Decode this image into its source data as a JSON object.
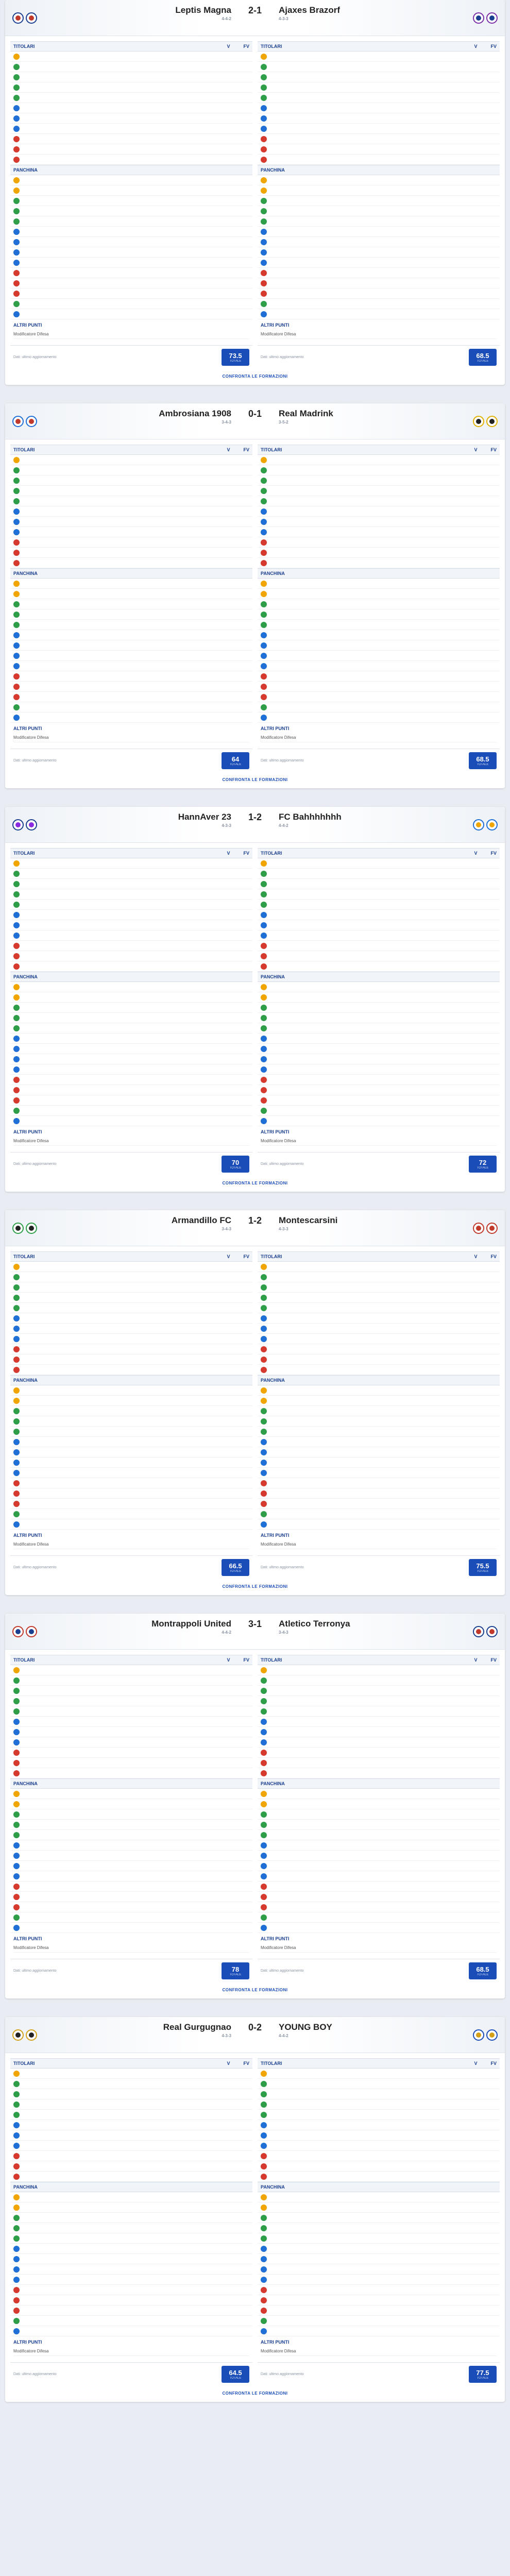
{
  "ui": {
    "titolari": "TITOLARI",
    "panchina": "PANCHINA",
    "altri_punti": "ALTRI PUNTI",
    "mod_difesa": "Modificatore Difesa",
    "totale": "TOTALE",
    "nota": "Dati: ultimo aggiornamento",
    "formazioni": "CONFRONTA LE FORMAZIONI",
    "v": "V",
    "fv": "FV"
  },
  "matches": [
    {
      "home": "Leptis Magna",
      "away": "Ajaxes Brazorf",
      "score": "2-1",
      "home_sub": "4-4-2",
      "away_sub": "4-3-3",
      "home_total": "73.5",
      "away_total": "68.5",
      "home_colors": [
        "#1a3f8f",
        "#c0392b"
      ],
      "away_colors": [
        "#7b2fa8",
        "#1a3f8f"
      ]
    },
    {
      "home": "Ambrosiana 1908",
      "away": "Real Madrink",
      "score": "0-1",
      "home_sub": "3-4-3",
      "away_sub": "3-5-2",
      "home_total": "64",
      "away_total": "68.5",
      "home_colors": [
        "#1f6fd6",
        "#c0392b"
      ],
      "away_colors": [
        "#e0b000",
        "#222"
      ]
    },
    {
      "home": "HannAver 23",
      "away": "FC Bahhhhhhh",
      "score": "1-2",
      "home_sub": "4-3-3",
      "away_sub": "4-4-2",
      "home_total": "70",
      "away_total": "72",
      "home_colors": [
        "#1a3f8f",
        "#8a2be2"
      ],
      "away_colors": [
        "#1f6fd6",
        "#f0a500"
      ]
    },
    {
      "home": "Armandillo FC",
      "away": "Montescarsini",
      "score": "1-2",
      "home_sub": "3-4-3",
      "away_sub": "4-3-3",
      "home_total": "66.5",
      "away_total": "75.5",
      "home_colors": [
        "#2e9e48",
        "#222"
      ],
      "away_colors": [
        "#c0392b",
        "#c0392b"
      ]
    },
    {
      "home": "Montrappoli United",
      "away": "Atletico Terronya",
      "score": "3-1",
      "home_sub": "4-4-2",
      "away_sub": "3-4-3",
      "home_total": "78",
      "away_total": "68.5",
      "home_colors": [
        "#c0392b",
        "#1a3f8f"
      ],
      "away_colors": [
        "#1a3f8f",
        "#c0392b"
      ]
    },
    {
      "home": "Real Gurgugnao",
      "away": "YOUNG BOY",
      "score": "0-2",
      "home_sub": "4-3-3",
      "away_sub": "4-4-2",
      "home_total": "64.5",
      "away_total": "77.5",
      "home_colors": [
        "#d4a017",
        "#222"
      ],
      "away_colors": [
        "#1a4db8",
        "#d4a017"
      ]
    }
  ]
}
